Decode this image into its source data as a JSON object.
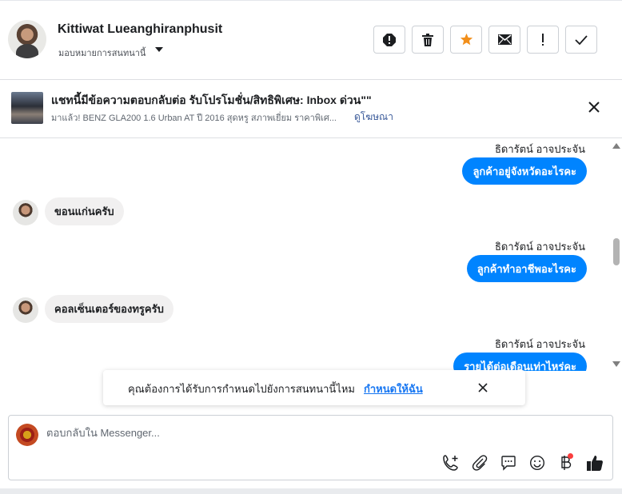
{
  "header": {
    "contact_name": "Kittiwat Lueanghiranphusit",
    "assign_label": "มอบหมายการสนทนานี้",
    "actions": [
      {
        "icon": "spam-icon"
      },
      {
        "icon": "trash-icon"
      },
      {
        "icon": "star-icon",
        "color": "#f28f1b"
      },
      {
        "icon": "envelope-icon"
      },
      {
        "icon": "exclamation-icon"
      },
      {
        "icon": "check-icon"
      }
    ]
  },
  "ad": {
    "title": "แชทนี้มีข้อความตอบกลับต่อ รับโปรโมชั่น/สิทธิพิเศษ: Inbox ด่วน\"\"",
    "subtitle": "มาแล้ว! BENZ GLA200 1.6 Urban AT ปี 2016 สุดหรู สภาพเยี่ยม ราคาพิเศ...",
    "link": "ดูโฆษณา"
  },
  "messages": [
    {
      "direction": "out",
      "sender": "ธิดารัตน์ อาจประจัน",
      "text": "ลูกค้าอยู่จังหวัดอะไรคะ"
    },
    {
      "direction": "in",
      "text": "ขอนแก่นครับ"
    },
    {
      "direction": "out",
      "sender": "ธิดารัตน์ อาจประจัน",
      "text": "ลูกค้าทำอาชีพอะไรคะ"
    },
    {
      "direction": "in",
      "text": "คอลเซ็นเตอร์ของทรูครับ"
    },
    {
      "direction": "out",
      "sender": "ธิดารัตน์ อาจประจัน",
      "text": "รายได้ต่อเดือนเท่าไหร่คะ"
    }
  ],
  "toast": {
    "text": "คุณต้องการได้รับการกำหนดไปยังการสนทนานี้ไหม",
    "link": "กำหนดให้ฉัน"
  },
  "composer": {
    "placeholder": "ตอบกลับใน Messenger...",
    "icons": [
      "add-call-icon",
      "attachment-icon",
      "saved-reply-icon",
      "emoji-icon",
      "payment-baht-icon",
      "thumbs-up-icon"
    ]
  },
  "colors": {
    "outgoing_bubble": "#0084ff",
    "incoming_bubble": "#f1f0f0",
    "link": "#385898",
    "star": "#f28f1b"
  }
}
